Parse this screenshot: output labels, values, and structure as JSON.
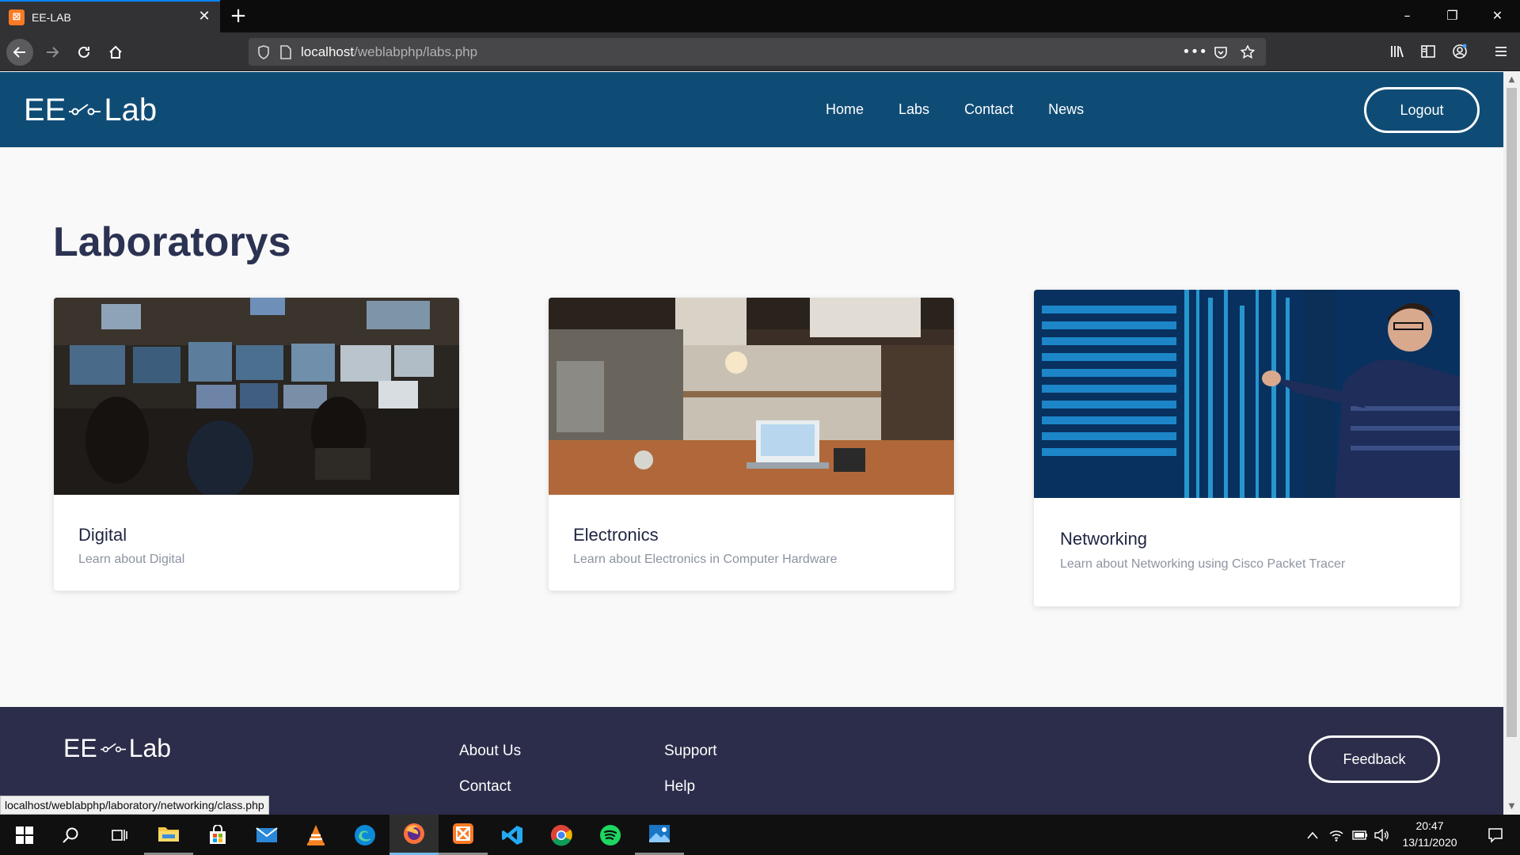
{
  "browser": {
    "tab_title": "EE-LAB",
    "url_host": "localhost",
    "url_path": "/weblabphp/labs.php",
    "status_url": "localhost/weblabphp/laboratory/networking/class.php"
  },
  "header": {
    "logo_left": "EE",
    "logo_right": "Lab",
    "nav": [
      "Home",
      "Labs",
      "Contact",
      "News"
    ],
    "logout_label": "Logout"
  },
  "main": {
    "title": "Laboratorys",
    "cards": [
      {
        "title": "Digital",
        "description": "Learn about Digital"
      },
      {
        "title": "Electronics",
        "description": "Learn about Electronics in Computer Hardware"
      },
      {
        "title": "Networking",
        "description": "Learn about Networking using Cisco Packet Tracer"
      }
    ]
  },
  "footer": {
    "logo_left": "EE",
    "logo_right": "Lab",
    "col1": [
      "About Us",
      "Contact"
    ],
    "col2": [
      "Support",
      "Help"
    ],
    "feedback_label": "Feedback"
  },
  "taskbar": {
    "time": "20:47",
    "date": "13/11/2020"
  },
  "colors": {
    "header_bg": "#0f4c75",
    "footer_bg": "#2b2d4a",
    "title_color": "#2c3252"
  }
}
